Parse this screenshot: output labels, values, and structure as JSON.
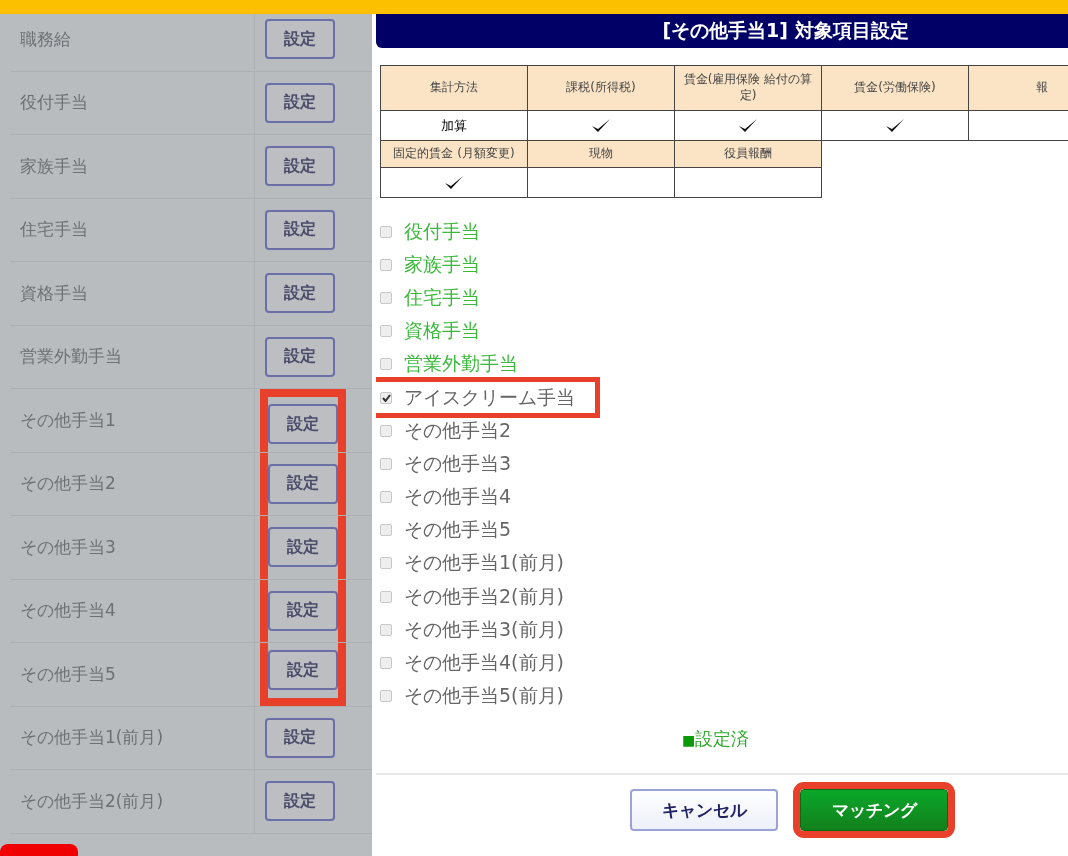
{
  "background_list": [
    {
      "name": "職務給",
      "button": "設定",
      "highlighted": false
    },
    {
      "name": "役付手当",
      "button": "設定",
      "highlighted": false
    },
    {
      "name": "家族手当",
      "button": "設定",
      "highlighted": false
    },
    {
      "name": "住宅手当",
      "button": "設定",
      "highlighted": false
    },
    {
      "name": "資格手当",
      "button": "設定",
      "highlighted": false
    },
    {
      "name": "営業外勤手当",
      "button": "設定",
      "highlighted": false
    },
    {
      "name": "その他手当1",
      "button": "設定",
      "highlighted": true
    },
    {
      "name": "その他手当2",
      "button": "設定",
      "highlighted": true
    },
    {
      "name": "その他手当3",
      "button": "設定",
      "highlighted": true
    },
    {
      "name": "その他手当4",
      "button": "設定",
      "highlighted": true
    },
    {
      "name": "その他手当5",
      "button": "設定",
      "highlighted": true
    },
    {
      "name": "その他手当1(前月)",
      "button": "設定",
      "highlighted": false
    },
    {
      "name": "その他手当2(前月)",
      "button": "設定",
      "highlighted": false
    }
  ],
  "dialog": {
    "title": "[その他手当1] 対象項目設定",
    "table": [
      {
        "headers": [
          "集計方法",
          "課税(所得税)",
          "賃金(雇用保険 給付の算定)",
          "賃金(労働保険)",
          "報"
        ],
        "values": [
          {
            "text": "加算",
            "checked": false
          },
          {
            "checked": true
          },
          {
            "checked": true
          },
          {
            "checked": true
          },
          {
            "checked": false
          }
        ]
      },
      {
        "headers": [
          "固定的賃金 (月額変更)",
          "現物",
          "役員報酬"
        ],
        "values": [
          {
            "checked": true
          },
          {
            "checked": false
          },
          {
            "checked": false
          }
        ]
      }
    ],
    "items": [
      {
        "label": "役付手当",
        "checked": false,
        "configured": true,
        "highlighted": false
      },
      {
        "label": "家族手当",
        "checked": false,
        "configured": true,
        "highlighted": false
      },
      {
        "label": "住宅手当",
        "checked": false,
        "configured": true,
        "highlighted": false
      },
      {
        "label": "資格手当",
        "checked": false,
        "configured": true,
        "highlighted": false
      },
      {
        "label": "営業外勤手当",
        "checked": false,
        "configured": true,
        "highlighted": false
      },
      {
        "label": "アイスクリーム手当",
        "checked": true,
        "configured": false,
        "highlighted": true
      },
      {
        "label": "その他手当2",
        "checked": false,
        "configured": false,
        "highlighted": false
      },
      {
        "label": "その他手当3",
        "checked": false,
        "configured": false,
        "highlighted": false
      },
      {
        "label": "その他手当4",
        "checked": false,
        "configured": false,
        "highlighted": false
      },
      {
        "label": "その他手当5",
        "checked": false,
        "configured": false,
        "highlighted": false
      },
      {
        "label": "その他手当1(前月)",
        "checked": false,
        "configured": false,
        "highlighted": false
      },
      {
        "label": "その他手当2(前月)",
        "checked": false,
        "configured": false,
        "highlighted": false
      },
      {
        "label": "その他手当3(前月)",
        "checked": false,
        "configured": false,
        "highlighted": false
      },
      {
        "label": "その他手当4(前月)",
        "checked": false,
        "configured": false,
        "highlighted": false
      },
      {
        "label": "その他手当5(前月)",
        "checked": false,
        "configured": false,
        "highlighted": false
      }
    ],
    "legend": {
      "marker": "■",
      "label": "設定済"
    },
    "buttons": [
      {
        "label": "キャンセル",
        "kind": "secondary",
        "highlighted": false
      },
      {
        "label": "マッチング",
        "kind": "primary",
        "highlighted": true
      }
    ]
  }
}
